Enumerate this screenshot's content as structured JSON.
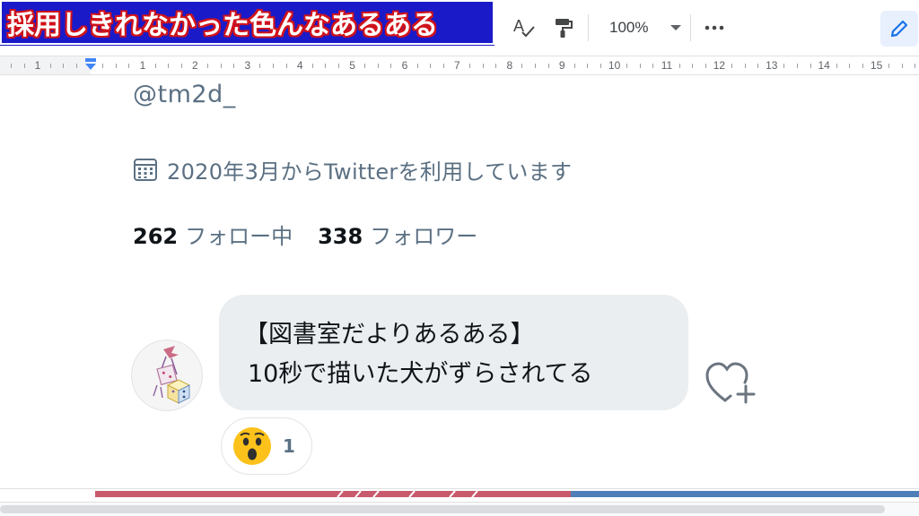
{
  "banner": {
    "title": "採用しきれなかった色んなあるある"
  },
  "toolbar": {
    "zoom": "100%",
    "icons": [
      "spellcheck-icon",
      "paint-format-icon",
      "more-icon",
      "edit-pencil-icon"
    ],
    "accent_color": "#1a73e8"
  },
  "ruler": {
    "numbers": [
      "1",
      "1",
      "2",
      "3",
      "4",
      "5",
      "6",
      "7",
      "8",
      "9",
      "10",
      "11",
      "12",
      "13",
      "14",
      "15"
    ]
  },
  "profile": {
    "handle": "@tm2d_",
    "joined": "2020年3月からTwitterを利用しています",
    "following_count": "262",
    "following_label": "フォロー中",
    "followers_count": "338",
    "followers_label": "フォロワー"
  },
  "message": {
    "line1": "【図書室だよりあるある】",
    "line2": "10秒で描いた犬がずらされてる",
    "reaction_emoji": "surprised-face",
    "reaction_count": "1"
  },
  "colors": {
    "banner_bg": "#1a1ac8",
    "banner_outline": "#d0121b",
    "muted_text": "#5b7083",
    "bubble_bg": "#ebeef0"
  }
}
